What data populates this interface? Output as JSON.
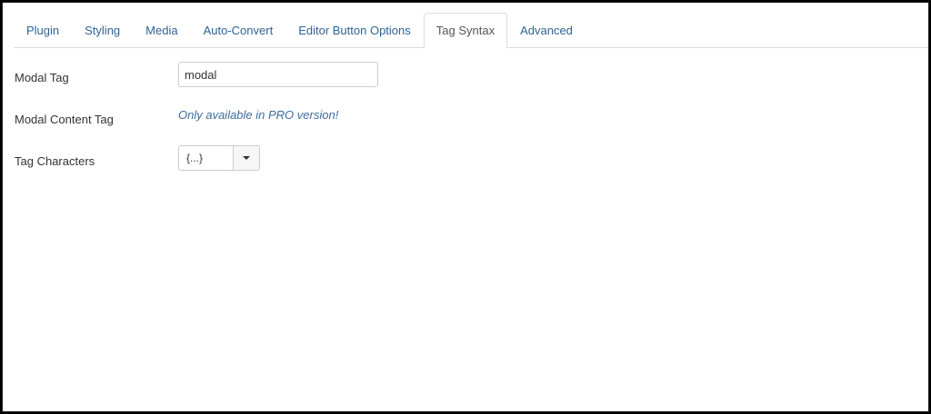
{
  "tabs": [
    {
      "label": "Plugin",
      "active": false
    },
    {
      "label": "Styling",
      "active": false
    },
    {
      "label": "Media",
      "active": false
    },
    {
      "label": "Auto-Convert",
      "active": false
    },
    {
      "label": "Editor Button Options",
      "active": false
    },
    {
      "label": "Tag Syntax",
      "active": true
    },
    {
      "label": "Advanced",
      "active": false
    }
  ],
  "form": {
    "modal_tag": {
      "label": "Modal Tag",
      "value": "modal"
    },
    "modal_content_tag": {
      "label": "Modal Content Tag",
      "note": "Only available in PRO version!"
    },
    "tag_characters": {
      "label": "Tag Characters",
      "selected": "{...}"
    }
  },
  "colors": {
    "link": "#2f6394",
    "pro_note": "#3c6d9c",
    "border": "#dddddd"
  },
  "icons": {
    "select_caret": "chevron-down-icon"
  }
}
